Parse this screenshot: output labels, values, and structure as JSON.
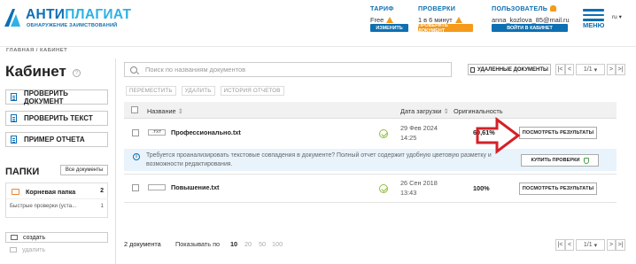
{
  "header": {
    "logo": {
      "title_a": "АНТИ",
      "title_b": "ПЛАГИАТ",
      "subtitle": "ОБНАРУЖЕНИЕ ЗАИМСТВОВАНИЙ"
    },
    "tariff": {
      "label": "ТАРИФ",
      "value": "Free",
      "button": "ИЗМЕНИТЬ"
    },
    "checks": {
      "label": "ПРОВЕРКИ",
      "value": "1 в 6 минут",
      "button": "ПРОВЕРИТЬ ДОКУМЕНТ"
    },
    "user": {
      "label": "ПОЛЬЗОВАТЕЛЬ",
      "email": "anna_kozlova_85@mail.ru",
      "button": "ВОЙТИ В КАБИНЕТ"
    },
    "menu_label": "МЕНЮ",
    "lang": "ru"
  },
  "breadcrumb": {
    "home": "ГЛАВНАЯ",
    "separator": "/",
    "current": "КАБИНЕТ"
  },
  "sidebar": {
    "title": "Кабинет",
    "buttons": [
      "ПРОВЕРИТЬ ДОКУМЕНТ",
      "ПРОВЕРИТЬ ТЕКСТ",
      "ПРИМЕР ОТЧЕТА"
    ],
    "folders_title": "ПАПКИ",
    "all_docs": "Все документы",
    "folders": [
      {
        "name": "Корневая папка",
        "count": "2"
      },
      {
        "name": "Быстрые проверки (уста...",
        "count": "1"
      }
    ],
    "create": "создать",
    "delete": "удалить"
  },
  "toolbar": {
    "search_placeholder": "Поиск по названиям документов",
    "deleted_docs": "УДАЛЕННЫЕ ДОКУМЕНТЫ",
    "pager": {
      "first": "|<",
      "prev": "<",
      "page": "1/1",
      "next": ">",
      "last": ">|"
    },
    "actions": [
      "ПЕРЕМЕСТИТЬ",
      "УДАЛИТЬ",
      "ИСТОРИЯ ОТЧЕТОВ"
    ]
  },
  "table": {
    "headers": {
      "name": "Название",
      "date": "Дата загрузки",
      "originality": "Оригинальность"
    },
    "rows": [
      {
        "type": ".TXT",
        "name": "Профессионально.txt",
        "date": "29 Фев 2024",
        "time": "14:25",
        "originality": "60,61%",
        "action": "ПОСМОТРЕТЬ РЕЗУЛЬТАТЫ"
      },
      {
        "type": "",
        "name": "Повышение.txt",
        "date": "26 Сен 2018",
        "time": "13:43",
        "originality": "100%",
        "action": "ПОСМОТРЕТЬ РЕЗУЛЬТАТЫ"
      }
    ],
    "info": {
      "text": "Требуется проанализировать текстовые совпадения в документе? Полный отчет содержит удобную цветовую разметку и возможности редактирования.",
      "button": "КУПИТЬ ПРОВЕРКИ"
    }
  },
  "footer": {
    "count": "2 документа",
    "show_by": "Показывать по",
    "sizes": [
      "10",
      "20",
      "50",
      "100"
    ],
    "pager_page": "1/1"
  },
  "colors": {
    "brand": "#0e6fb2",
    "brand_light": "#2db1e6",
    "warning": "#f59a1b",
    "success": "#8dbd3e",
    "arrow": "#d52027"
  }
}
